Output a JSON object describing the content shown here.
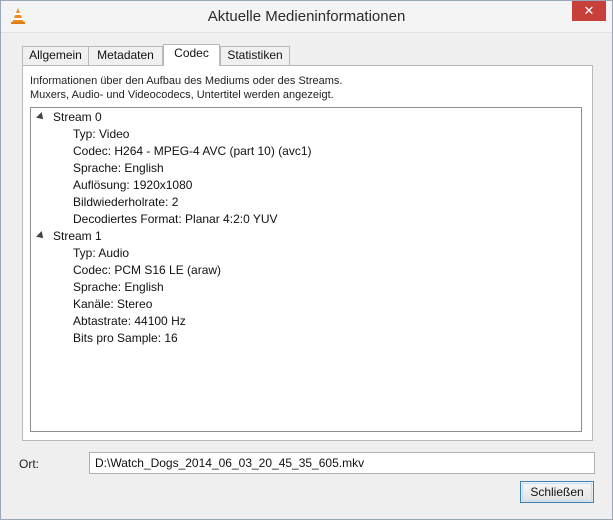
{
  "window": {
    "title": "Aktuelle Medieninformationen",
    "close_symbol": "✕",
    "app_icon": "vlc-cone-icon",
    "close_color": "#c7413a"
  },
  "tabs": [
    {
      "label": "Allgemein",
      "active": false
    },
    {
      "label": "Metadaten",
      "active": false
    },
    {
      "label": "Codec",
      "active": true
    },
    {
      "label": "Statistiken",
      "active": false
    }
  ],
  "codec": {
    "description_line1": "Informationen über den Aufbau des Mediums oder des Streams.",
    "description_line2": "Muxers, Audio- und Videocodecs, Untertitel werden angezeigt.",
    "streams": [
      {
        "title": "Stream 0",
        "expanded": true,
        "items": [
          "Typ: Video",
          "Codec: H264 - MPEG-4 AVC (part 10) (avc1)",
          "Sprache: English",
          "Auflösung: 1920x1080",
          "Bildwiederholrate: 2",
          "Decodiertes Format: Planar 4:2:0 YUV"
        ]
      },
      {
        "title": "Stream 1",
        "expanded": true,
        "items": [
          "Typ: Audio",
          "Codec: PCM S16 LE (araw)",
          "Sprache: English",
          "Kanäle: Stereo",
          "Abtastrate: 44100 Hz",
          "Bits pro Sample: 16"
        ]
      }
    ]
  },
  "location": {
    "label": "Ort:",
    "value": "D:\\Watch_Dogs_2014_06_03_20_45_35_605.mkv"
  },
  "footer": {
    "close_label": "Schließen"
  },
  "colors": {
    "focus_border": "#3c7fb1",
    "window_bg": "#efefef"
  }
}
